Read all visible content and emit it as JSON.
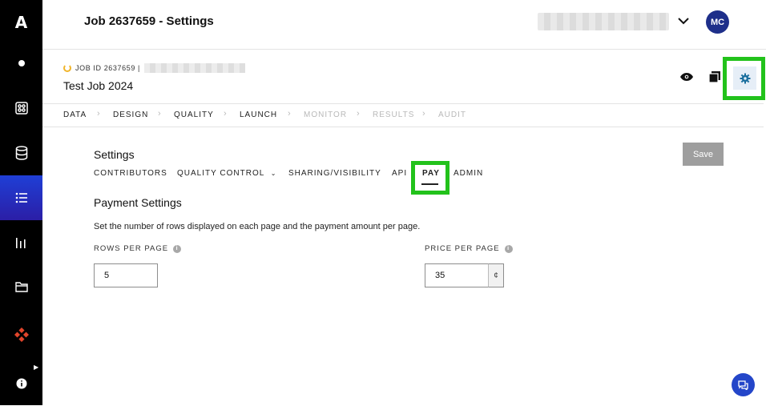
{
  "sidebar": {
    "logo": "A",
    "items": [
      {
        "name": "home",
        "icon": "dot-icon"
      },
      {
        "name": "jobs",
        "icon": "grid-icon"
      },
      {
        "name": "data",
        "icon": "database-icon"
      },
      {
        "name": "tasks",
        "icon": "list-icon",
        "active": true
      },
      {
        "name": "analytics",
        "icon": "bar-chart-icon"
      },
      {
        "name": "folders",
        "icon": "folder-icon"
      },
      {
        "name": "integrations",
        "icon": "diamond-icon"
      },
      {
        "name": "info",
        "icon": "info-icon"
      }
    ],
    "accent": "#2b34d0"
  },
  "header": {
    "title": "Job 2637659 - Settings",
    "avatar_initials": "MC"
  },
  "job": {
    "meta_label": "JOB ID 2637659 |",
    "name": "Test Job 2024"
  },
  "steps": [
    {
      "label": "DATA",
      "enabled": true
    },
    {
      "label": "DESIGN",
      "enabled": true
    },
    {
      "label": "QUALITY",
      "enabled": true
    },
    {
      "label": "LAUNCH",
      "enabled": true
    },
    {
      "label": "MONITOR",
      "enabled": false
    },
    {
      "label": "RESULTS",
      "enabled": false
    },
    {
      "label": "AUDIT",
      "enabled": false
    }
  ],
  "settings": {
    "title": "Settings",
    "save_label": "Save",
    "tabs": [
      "CONTRIBUTORS",
      "QUALITY CONTROL",
      "SHARING/VISIBILITY",
      "API",
      "PAY",
      "ADMIN"
    ],
    "active_tab": "PAY"
  },
  "payment": {
    "title": "Payment Settings",
    "description": "Set the number of rows displayed on each page and the payment amount per page.",
    "rows_label": "ROWS PER PAGE",
    "rows_value": "5",
    "price_label": "PRICE PER PAGE",
    "price_value": "35",
    "price_suffix": "¢"
  },
  "colors": {
    "highlight": "#22c21b",
    "avatar_bg": "#1e2f8a",
    "fab_bg": "#2446c9",
    "save_disabled": "#9e9e9e"
  }
}
